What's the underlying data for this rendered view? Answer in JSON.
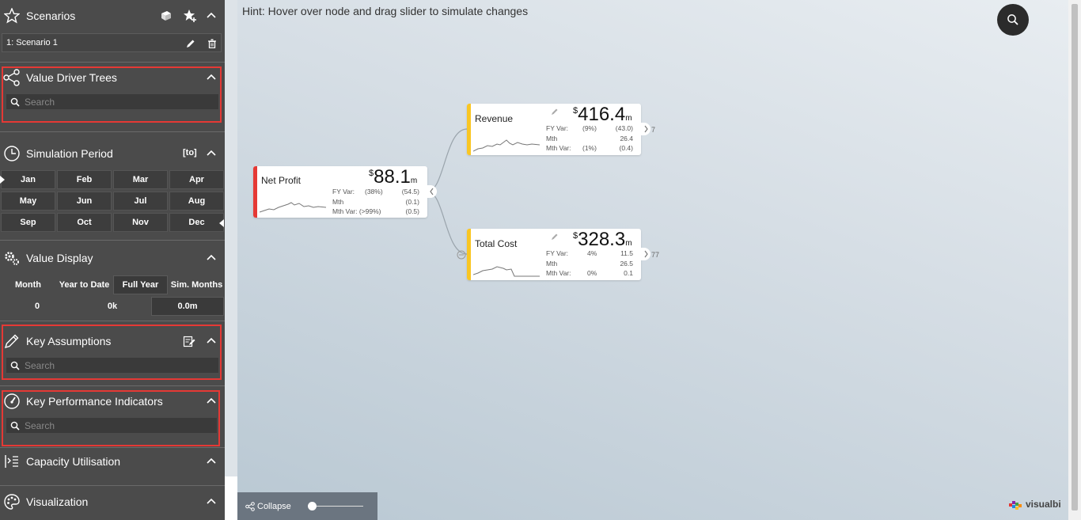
{
  "sidebar": {
    "scenarios": {
      "title": "Scenarios",
      "item": "1: Scenario 1"
    },
    "value_driver_trees": {
      "title": "Value Driver Trees",
      "search_placeholder": "Search"
    },
    "simulation_period": {
      "title": "Simulation Period",
      "badge": "[to]",
      "months": [
        "Jan",
        "Feb",
        "Mar",
        "Apr",
        "May",
        "Jun",
        "Jul",
        "Aug",
        "Sep",
        "Oct",
        "Nov",
        "Dec"
      ]
    },
    "value_display": {
      "title": "Value Display",
      "options": [
        "Month",
        "Year to Date",
        "Full Year",
        "Sim. Months"
      ],
      "selected": "Full Year",
      "values": [
        "0",
        "0k",
        "0.0m"
      ]
    },
    "key_assumptions": {
      "title": "Key Assumptions",
      "search_placeholder": "Search"
    },
    "kpis": {
      "title": "Key Performance Indicators",
      "search_placeholder": "Search"
    },
    "capacity": {
      "title": "Capacity Utilisation"
    },
    "visualization": {
      "title": "Visualization"
    }
  },
  "canvas": {
    "hint": "Hint: Hover over node and drag slider to simulate changes",
    "nodes": {
      "net_profit": {
        "name": "Net Profit",
        "currency": "$",
        "value": "88.1",
        "unit": "m",
        "fy_var_label": "FY Var:",
        "fy_var_pct": "(38%)",
        "fy_var_val": "(54.5)",
        "mth_label": "Mth",
        "mth_val": "(0.1)",
        "mth_var_label": "Mth Var: (>99%)",
        "mth_var_val": "(0.5)",
        "color": "#e53935"
      },
      "revenue": {
        "name": "Revenue",
        "currency": "$",
        "value": "416.4",
        "unit": "m",
        "fy_var_label": "FY Var:",
        "fy_var_pct": "(9%)",
        "fy_var_val": "(43.0)",
        "mth_label": "Mth",
        "mth_val": "26.4",
        "mth_var_label": "Mth Var:",
        "mth_var_pct": "(1%)",
        "mth_var_val": "(0.4)",
        "count": "7",
        "color": "#f9c623"
      },
      "total_cost": {
        "name": "Total Cost",
        "currency": "$",
        "value": "328.3",
        "unit": "m",
        "fy_var_label": "FY Var:",
        "fy_var_pct": "4%",
        "fy_var_val": "11.5",
        "mth_label": "Mth",
        "mth_val": "26.5",
        "mth_var_label": "Mth Var:",
        "mth_var_pct": "0%",
        "mth_var_val": "0.1",
        "count": "77",
        "color": "#f9c623"
      }
    }
  },
  "bottom_bar": {
    "collapse_label": "Collapse"
  },
  "logo": {
    "text": "visualbi"
  }
}
